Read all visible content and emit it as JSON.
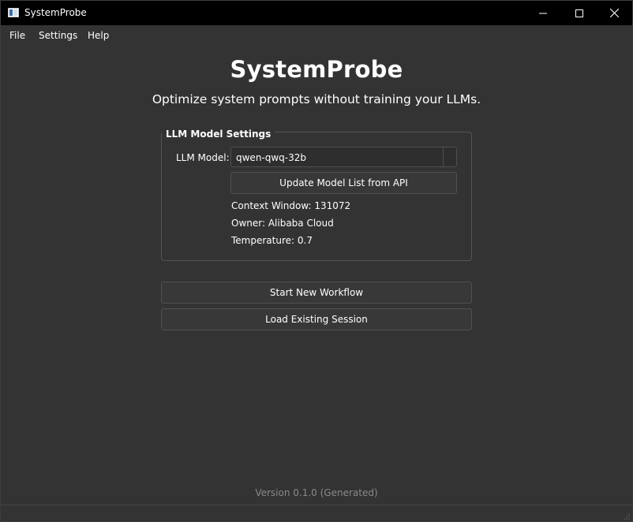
{
  "window": {
    "title": "SystemProbe",
    "icon": "app-window-icon"
  },
  "menu": {
    "items": [
      "File",
      "Settings",
      "Help"
    ]
  },
  "main": {
    "title": "SystemProbe",
    "subtitle": "Optimize system prompts without training your LLMs."
  },
  "settings": {
    "group_title": "LLM Model Settings",
    "model_label": "LLM Model:",
    "model_value": "qwen-qwq-32b",
    "update_button": "Update Model List from API",
    "context_window": "Context Window: 131072",
    "owner": "Owner: Alibaba Cloud",
    "temperature": "Temperature: 0.7"
  },
  "actions": {
    "start": "Start New Workflow",
    "load": "Load Existing Session"
  },
  "footer": {
    "version": "Version 0.1.0 (Generated)"
  },
  "colors": {
    "background": "#333333",
    "titlebar": "#000000",
    "button": "#383838",
    "muted_text": "#8a8a8a"
  }
}
